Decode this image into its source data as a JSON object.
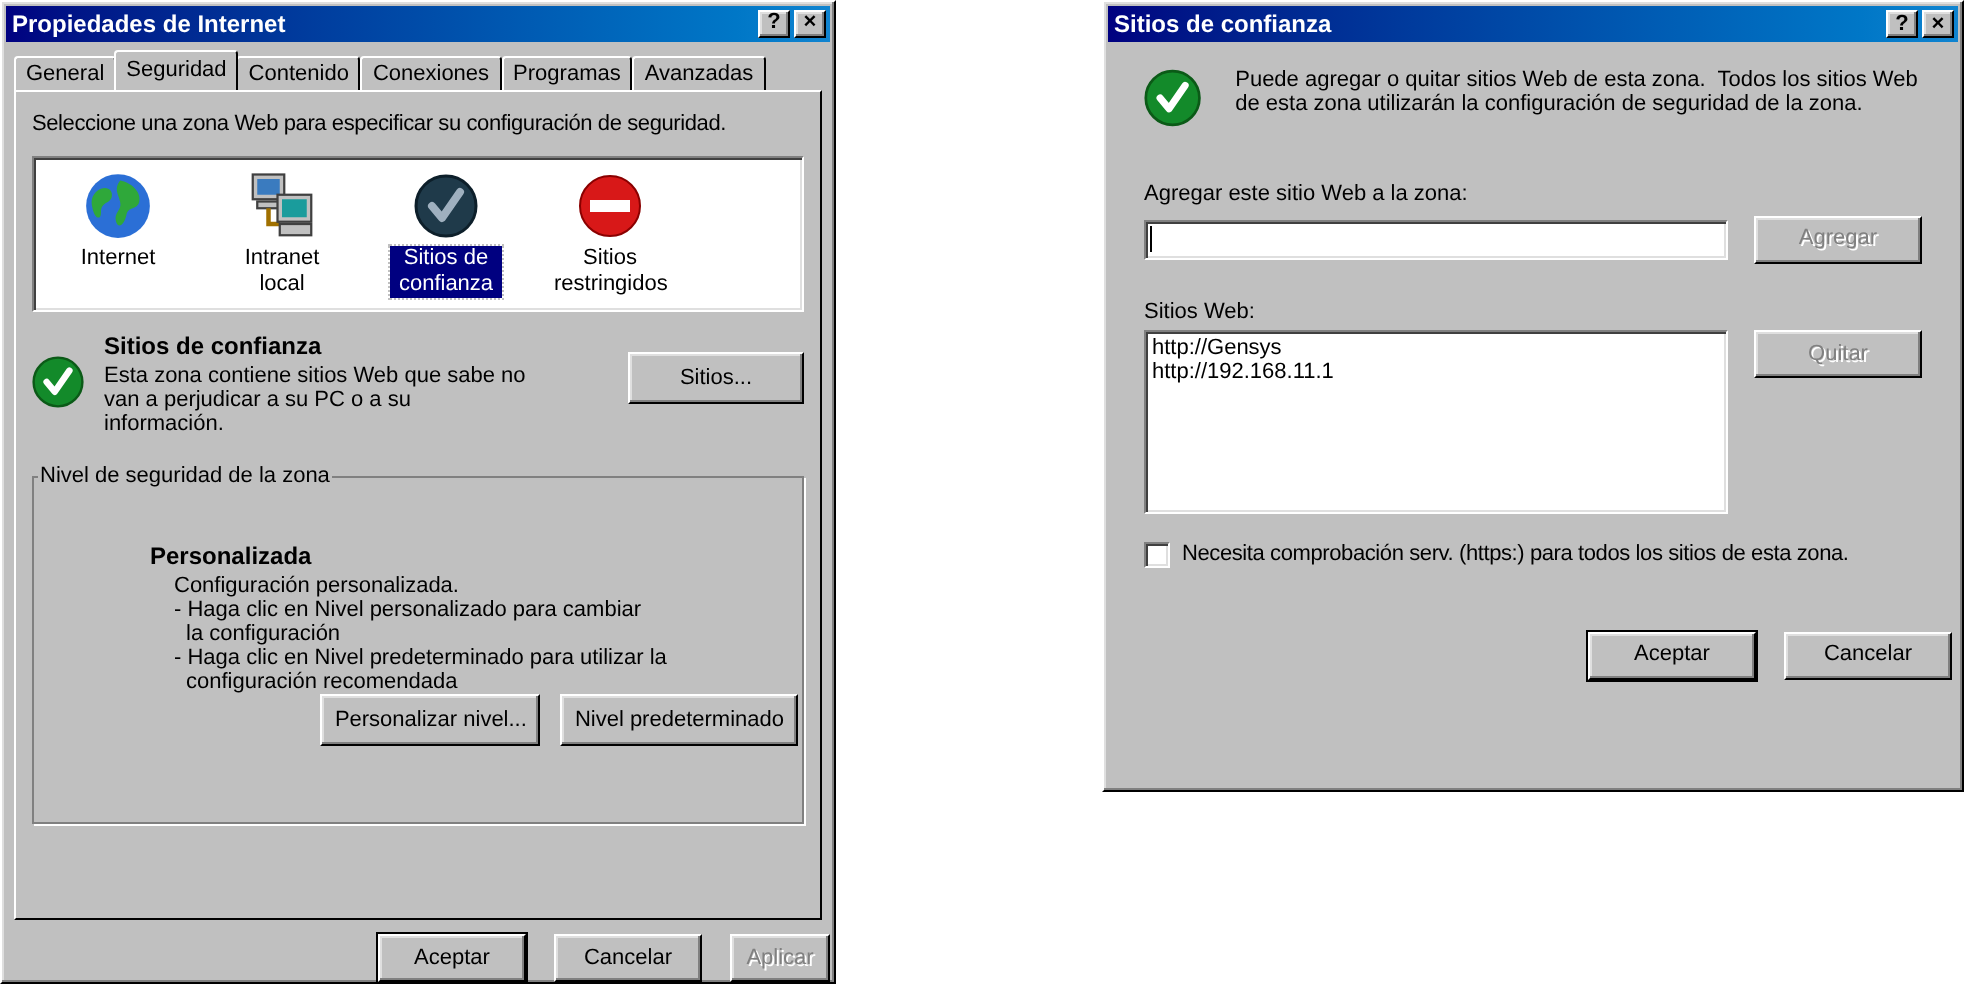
{
  "internet_properties": {
    "title": "Propiedades de Internet",
    "title_buttons": [
      "?",
      "×"
    ],
    "tabs": [
      {
        "label": "General",
        "selected": false
      },
      {
        "label": "Seguridad",
        "selected": true
      },
      {
        "label": "Contenido",
        "selected": false
      },
      {
        "label": "Conexiones",
        "selected": false
      },
      {
        "label": "Programas",
        "selected": false
      },
      {
        "label": "Avanzadas",
        "selected": false
      }
    ],
    "instruction": "Seleccione una zona Web para especificar su configuración de seguridad.",
    "zones": [
      {
        "kind": "internet",
        "label": "Internet",
        "selected": false
      },
      {
        "kind": "intranet",
        "label": "Intranet local",
        "selected": false
      },
      {
        "kind": "trusted",
        "label": "Sitios de confianza",
        "selected": true
      },
      {
        "kind": "restricted",
        "label": "Sitios restringidos",
        "selected": false
      }
    ],
    "zone_info": {
      "title": "Sitios de confianza",
      "description": "Esta zona contiene sitios Web que sabe no van a perjudicar a su PC o a su información.",
      "button": "Sitios..."
    },
    "security_level": {
      "legend": "Nivel de seguridad de la zona",
      "title": "Personalizada",
      "lines": [
        "Configuración personalizada.",
        "- Haga clic en Nivel personalizado para cambiar",
        "la configuración",
        "- Haga clic en Nivel predeterminado para utilizar la",
        "configuración recomendada"
      ],
      "buttons": [
        "Personalizar nivel...",
        "Nivel predeterminado"
      ]
    },
    "buttons": [
      {
        "label": "Aceptar",
        "disabled": false,
        "default": true
      },
      {
        "label": "Cancelar",
        "disabled": false,
        "default": false
      },
      {
        "label": "Aplicar",
        "disabled": true,
        "default": false
      }
    ]
  },
  "trusted_sites_dialog": {
    "title": "Sitios de confianza",
    "title_buttons": [
      "?",
      "×"
    ],
    "message": "Puede agregar o quitar sitios Web de esta zona.  Todos los sitios Web de esta zona utilizarán la configuración de seguridad de la zona.",
    "add_label": "Agregar este sitio Web a la zona:",
    "add_button": {
      "label": "Agregar",
      "disabled": true
    },
    "sites_label": "Sitios Web:",
    "sites": [
      "http://Gensys",
      "http://192.168.11.1"
    ],
    "remove_button": {
      "label": "Quitar",
      "disabled": true
    },
    "https_checkbox": {
      "label": "Necesita comprobación serv. (https:) para todos los sitios de esta zona.",
      "checked": false
    },
    "buttons": [
      {
        "label": "Aceptar",
        "disabled": false,
        "default": true
      },
      {
        "label": "Cancelar",
        "disabled": false,
        "default": false
      }
    ]
  }
}
